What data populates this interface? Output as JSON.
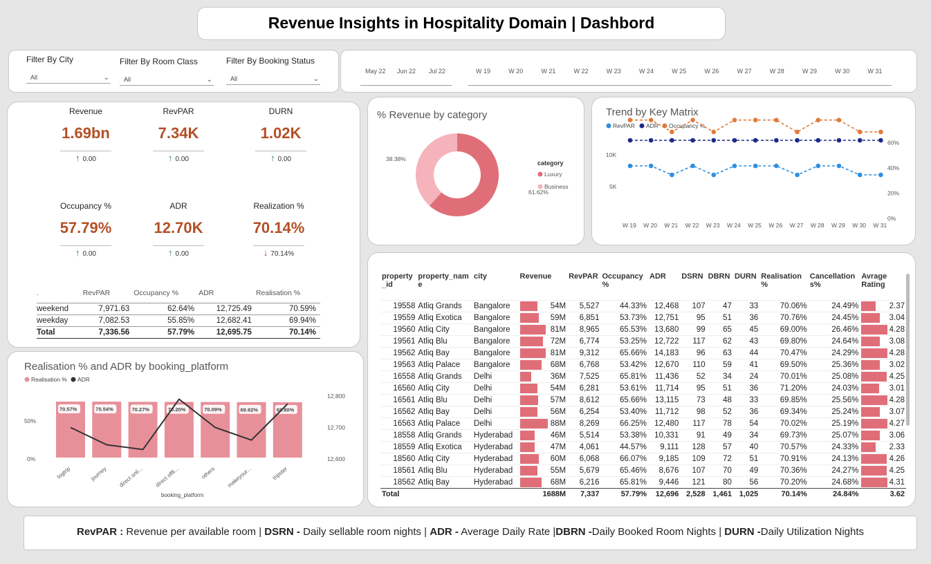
{
  "title": "Revenue Insights in Hospitality Domain | Dashbord",
  "filters": [
    {
      "label": "Filter By City",
      "value": "All"
    },
    {
      "label": "Filter By Room Class",
      "value": "All"
    },
    {
      "label": "Filter By Booking Status",
      "value": "All"
    }
  ],
  "timeline": {
    "months": [
      "May 22",
      "Jun 22",
      "Jul 22"
    ],
    "weeks": [
      "W 19",
      "W 20",
      "W 21",
      "W 22",
      "W 23",
      "W 24",
      "W 25",
      "W 26",
      "W 27",
      "W 28",
      "W 29",
      "W 30",
      "W 31"
    ]
  },
  "kpis": [
    {
      "label": "Revenue",
      "value": "1.69bn",
      "delta": "0.00",
      "trend": "up"
    },
    {
      "label": "RevPAR",
      "value": "7.34K",
      "delta": "0.00",
      "trend": "up"
    },
    {
      "label": "DURN",
      "value": "1.02K",
      "delta": "0.00",
      "trend": "up"
    },
    {
      "label": "Occupancy %",
      "value": "57.79%",
      "delta": "0.00",
      "trend": "up"
    },
    {
      "label": "ADR",
      "value": "12.70K",
      "delta": "0.00",
      "trend": "up"
    },
    {
      "label": "Realization %",
      "value": "70.14%",
      "delta": "70.14%",
      "trend": "down"
    }
  ],
  "day_table": {
    "headers": [
      ".",
      "RevPAR",
      "Occupancy %",
      "ADR",
      "Realisation %"
    ],
    "rows": [
      [
        "weekend",
        "7,971.63",
        "62.64%",
        "12,725.49",
        "70.59%"
      ],
      [
        "weekday",
        "7,082.53",
        "55.85%",
        "12,682.41",
        "69.94%"
      ]
    ],
    "total": [
      "Total",
      "7,336.56",
      "57.79%",
      "12,695.75",
      "70.14%"
    ]
  },
  "donut": {
    "title": "% Revenue by category",
    "legend_title": "category",
    "colors": {
      "Luxury": "#e06e78",
      "Business": "#f5b3bb"
    }
  },
  "trend": {
    "title": "Trend by Key Matrix",
    "legend": [
      "RevPAR",
      "ADR",
      "Occupancy %"
    ],
    "colors": {
      "RevPAR": "#2d8fe0",
      "ADR": "#1d2a8c",
      "Occupancy %": "#e07a3a"
    }
  },
  "realisation": {
    "title": "Realisation % and ADR by booking_platform",
    "legend": [
      "Realisation %",
      "ADR"
    ],
    "xlabel": "booking_platform",
    "colors": {
      "bar": "#e8909a",
      "line": "#333333"
    }
  },
  "chart_data": [
    {
      "type": "pie",
      "title": "% Revenue by category",
      "legend_title": "category",
      "categories": [
        "Luxury",
        "Business"
      ],
      "values": [
        61.62,
        38.38
      ],
      "labels": [
        "61.62%",
        "38.38%"
      ]
    },
    {
      "type": "line",
      "title": "Trend by Key Matrix",
      "x": [
        "W 19",
        "W 20",
        "W 21",
        "W 22",
        "W 23",
        "W 24",
        "W 25",
        "W 26",
        "W 27",
        "W 28",
        "W 29",
        "W 30",
        "W 31"
      ],
      "series": [
        {
          "name": "RevPAR",
          "axis": "left",
          "values": [
            7900,
            7900,
            6600,
            7900,
            6600,
            7900,
            7900,
            7900,
            6600,
            7900,
            7900,
            6600,
            6600
          ]
        },
        {
          "name": "ADR",
          "axis": "left",
          "values": [
            12700,
            12700,
            12700,
            12700,
            12700,
            12700,
            12700,
            12700,
            12700,
            12700,
            12700,
            12700,
            12700
          ]
        },
        {
          "name": "Occupancy %",
          "axis": "right",
          "values": [
            62,
            62,
            52,
            62,
            52,
            62,
            62,
            62,
            52,
            62,
            62,
            52,
            52
          ]
        }
      ],
      "y_left_ticks": [
        "5K",
        "10K"
      ],
      "y_right_ticks": [
        "0%",
        "20%",
        "40%",
        "60%"
      ],
      "y_left_lim": [
        0,
        15000
      ],
      "y_right_lim": [
        0,
        70
      ]
    },
    {
      "type": "bar",
      "title": "Realisation % and ADR by booking_platform",
      "categories": [
        "logtrip",
        "journey",
        "direct onli...",
        "direct offli...",
        "others",
        "makeyour...",
        "tripster"
      ],
      "series": [
        {
          "name": "Realisation %",
          "axis": "left",
          "values": [
            70.57,
            70.54,
            70.27,
            70.2,
            70.09,
            69.92,
            69.8
          ],
          "labels": [
            "70.57%",
            "70.54%",
            "70.27%",
            "70.20%",
            "70.09%",
            "69.92%",
            "69.80%"
          ]
        },
        {
          "name": "ADR",
          "axis": "right",
          "type": "line",
          "values": [
            12700,
            12645,
            12630,
            12790,
            12700,
            12660,
            12775
          ]
        }
      ],
      "xlabel": "booking_platform",
      "y_left_ticks": [
        "0%",
        "50%"
      ],
      "y_right_ticks": [
        "12,600",
        "12,700",
        "12,800"
      ],
      "y_left_lim": [
        0,
        100
      ],
      "y_right_lim": [
        12600,
        12800
      ]
    }
  ],
  "property_table": {
    "headers": [
      "property _id",
      "property_nam e",
      "city",
      "Revenue",
      "RevPAR",
      "Occupancy %",
      "ADR",
      "DSRN",
      "DBRN",
      "DURN",
      "Realisation %",
      "Cancellation s%",
      "Avrage Rating"
    ],
    "rows": [
      [
        "19558",
        "Atliq Grands",
        "Bangalore",
        "54M",
        "5,527",
        "44.33%",
        "12,468",
        "107",
        "47",
        "33",
        "70.06%",
        "24.49%",
        "2.37"
      ],
      [
        "19559",
        "Atliq Exotica",
        "Bangalore",
        "59M",
        "6,851",
        "53.73%",
        "12,751",
        "95",
        "51",
        "36",
        "70.76%",
        "24.45%",
        "3.04"
      ],
      [
        "19560",
        "Atliq City",
        "Bangalore",
        "81M",
        "8,965",
        "65.53%",
        "13,680",
        "99",
        "65",
        "45",
        "69.00%",
        "26.46%",
        "4.28"
      ],
      [
        "19561",
        "Atliq Blu",
        "Bangalore",
        "72M",
        "6,774",
        "53.25%",
        "12,722",
        "117",
        "62",
        "43",
        "69.80%",
        "24.64%",
        "3.08"
      ],
      [
        "19562",
        "Atliq Bay",
        "Bangalore",
        "81M",
        "9,312",
        "65.66%",
        "14,183",
        "96",
        "63",
        "44",
        "70.47%",
        "24.29%",
        "4.28"
      ],
      [
        "19563",
        "Atliq Palace",
        "Bangalore",
        "68M",
        "6,768",
        "53.42%",
        "12,670",
        "110",
        "59",
        "41",
        "69.50%",
        "25.36%",
        "3.02"
      ],
      [
        "16558",
        "Atliq Grands",
        "Delhi",
        "36M",
        "7,525",
        "65.81%",
        "11,436",
        "52",
        "34",
        "24",
        "70.01%",
        "25.08%",
        "4.25"
      ],
      [
        "16560",
        "Atliq City",
        "Delhi",
        "54M",
        "6,281",
        "53.61%",
        "11,714",
        "95",
        "51",
        "36",
        "71.20%",
        "24.03%",
        "3.01"
      ],
      [
        "16561",
        "Atliq Blu",
        "Delhi",
        "57M",
        "8,612",
        "65.66%",
        "13,115",
        "73",
        "48",
        "33",
        "69.85%",
        "25.56%",
        "4.28"
      ],
      [
        "16562",
        "Atliq Bay",
        "Delhi",
        "56M",
        "6,254",
        "53.40%",
        "11,712",
        "98",
        "52",
        "36",
        "69.34%",
        "25.24%",
        "3.07"
      ],
      [
        "16563",
        "Atliq Palace",
        "Delhi",
        "88M",
        "8,269",
        "66.25%",
        "12,480",
        "117",
        "78",
        "54",
        "70.02%",
        "25.19%",
        "4.27"
      ],
      [
        "18558",
        "Atliq Grands",
        "Hyderabad",
        "46M",
        "5,514",
        "53.38%",
        "10,331",
        "91",
        "49",
        "34",
        "69.73%",
        "25.07%",
        "3.06"
      ],
      [
        "18559",
        "Atliq Exotica",
        "Hyderabad",
        "47M",
        "4,061",
        "44.57%",
        "9,111",
        "128",
        "57",
        "40",
        "70.57%",
        "24.33%",
        "2.33"
      ],
      [
        "18560",
        "Atliq City",
        "Hyderabad",
        "60M",
        "6,068",
        "66.07%",
        "9,185",
        "109",
        "72",
        "51",
        "70.91%",
        "24.13%",
        "4.26"
      ],
      [
        "18561",
        "Atliq Blu",
        "Hyderabad",
        "55M",
        "5,679",
        "65.46%",
        "8,676",
        "107",
        "70",
        "49",
        "70.36%",
        "24.27%",
        "4.25"
      ],
      [
        "18562",
        "Atliq Bay",
        "Hyderabad",
        "68M",
        "6,216",
        "65.81%",
        "9,446",
        "121",
        "80",
        "56",
        "70.20%",
        "24.68%",
        "4.31"
      ]
    ],
    "total": [
      "Total",
      "",
      "",
      "1688M",
      "7,337",
      "57.79%",
      "12,696",
      "2,528",
      "1,461",
      "1,025",
      "70.14%",
      "24.84%",
      "3.62"
    ],
    "bar_color": "#e06e78"
  },
  "footer": [
    {
      "b": "RevPAR :",
      "t": " Revenue per available room | "
    },
    {
      "b": "DSRN -",
      "t": " Daily sellable room nights | "
    },
    {
      "b": "ADR -",
      "t": " Average Daily Rate |"
    },
    {
      "b": "DBRN -",
      "t": "Daily Booked Room Nights | "
    },
    {
      "b": "DURN -",
      "t": "Daily Utilization Nights"
    }
  ]
}
